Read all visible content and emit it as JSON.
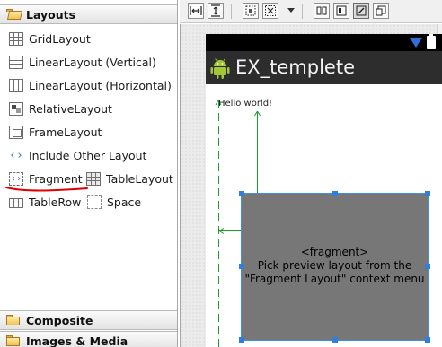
{
  "palette": {
    "header_top": "Layouts",
    "items": [
      {
        "label": "GridLayout",
        "icon": "grid-layout-icon"
      },
      {
        "label": "LinearLayout (Vertical)",
        "icon": "linear-layout-vertical-icon"
      },
      {
        "label": "LinearLayout (Horizontal)",
        "icon": "linear-layout-horizontal-icon"
      },
      {
        "label": "RelativeLayout",
        "icon": "relative-layout-icon"
      },
      {
        "label": "FrameLayout",
        "icon": "frame-layout-icon"
      },
      {
        "label": "Include Other Layout",
        "icon": "include-layout-icon"
      },
      {
        "label": "Fragment",
        "icon": "fragment-icon"
      },
      {
        "label": "TableLayout",
        "icon": "table-layout-icon"
      },
      {
        "label": "TableRow",
        "icon": "table-row-icon"
      },
      {
        "label": "Space",
        "icon": "space-icon"
      }
    ],
    "header_composite": "Composite",
    "header_images": "Images & Media",
    "annotation_color": "#e00000"
  },
  "device": {
    "app_title": "EX_templete",
    "hello_text": "Hello world!",
    "fragment_lines": [
      "<fragment>",
      "Pick preview layout from the",
      "\"Fragment Layout\" context menu"
    ],
    "status_icon_color": "#2f6fd6",
    "selection_color": "#3b8fe6",
    "guide_color": "#1f9a2c"
  }
}
